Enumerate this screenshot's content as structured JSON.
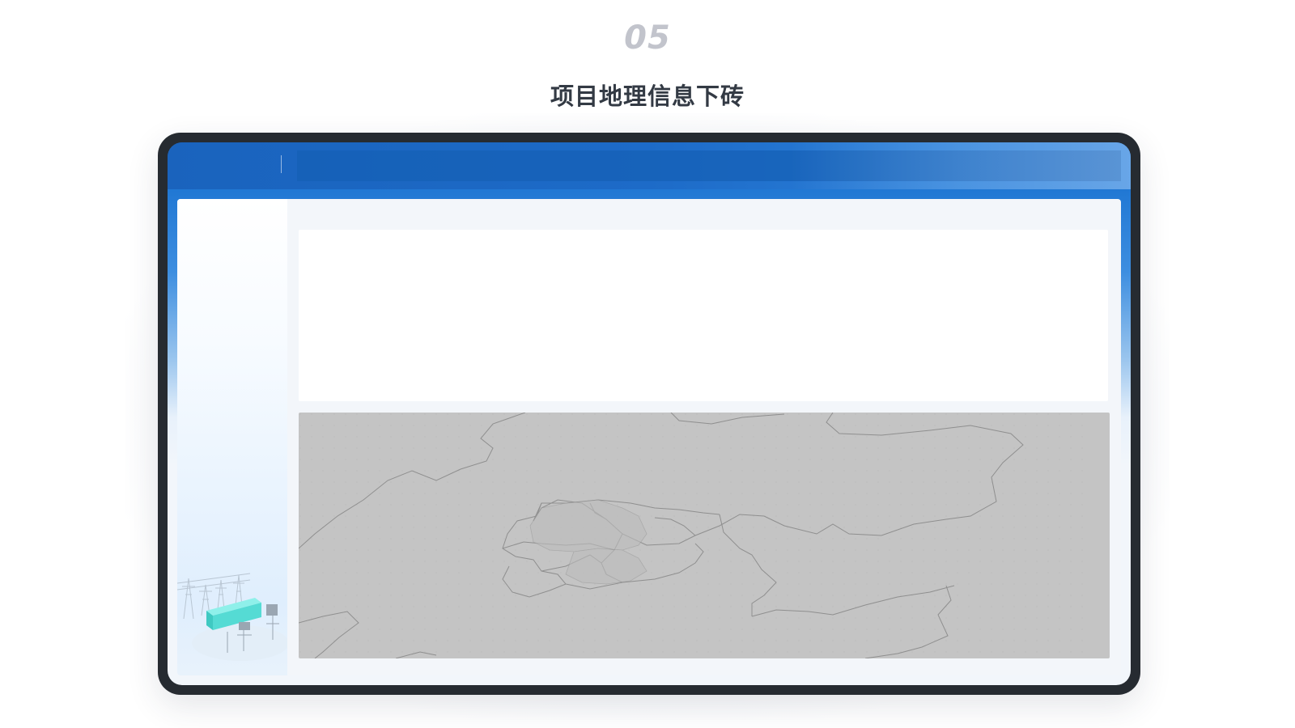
{
  "header": {
    "step_number": "05",
    "title": "项目地理信息下砖"
  },
  "colors": {
    "accent_blue": "#1e67bf",
    "device_frame": "#262b31",
    "map_fill": "#c4c4c4",
    "illustration_teal": "#4fd6cf"
  },
  "icons": {
    "sidebar_illustration": "power-substation-illustration"
  }
}
